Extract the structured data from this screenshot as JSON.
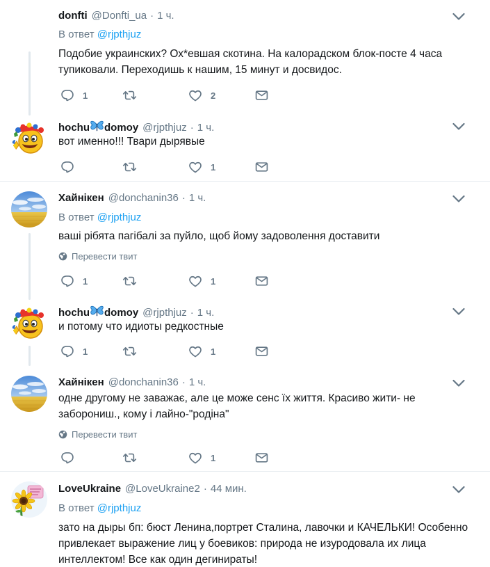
{
  "labels": {
    "reply_prefix": "В ответ",
    "translate": "Перевести твит",
    "dot": "·"
  },
  "tweets": [
    {
      "fullname": "donfti",
      "username": "@Donfti_ua",
      "time": "1 ч.",
      "reply_to": "@rjpthjuz",
      "text": "Подобие украинских? Ох*евшая скотина. На калорадском блок-посте 4 часа тупиковали. Переходишь к нашим, 15 минут и досвидос.",
      "reply_count": "1",
      "like_count": "2"
    },
    {
      "fullname_a": "hochu",
      "fullname_b": "domoy",
      "username": "@rjpthjuz",
      "time": "1 ч.",
      "text": "вот именно!!! Твари дырявые",
      "reply_count": "",
      "like_count": "1"
    },
    {
      "fullname": "Хайнікен",
      "username": "@donchanin36",
      "time": "1 ч.",
      "reply_to": "@rjpthjuz",
      "text": "ваші рібята пагібалі за пуйло, щоб йому задоволення доставити",
      "reply_count": "1",
      "like_count": "1"
    },
    {
      "fullname_a": "hochu",
      "fullname_b": "domoy",
      "username": "@rjpthjuz",
      "time": "1 ч.",
      "text": "и потому что идиоты редкостные",
      "reply_count": "1",
      "like_count": "1"
    },
    {
      "fullname": "Хайнікен",
      "username": "@donchanin36",
      "time": "1 ч.",
      "text": "одне другому не заважає, але це може сенс їх життя. Красиво жити- не заборониш., кому і лайно-\"родіна\"",
      "reply_count": "",
      "like_count": "1"
    },
    {
      "fullname": "LoveUkraine",
      "username": "@LoveUkraine2",
      "time": "44 мин.",
      "reply_to": "@rjpthjuz",
      "text": "зато на дыры бп: бюст Ленина,портрет Сталина, лавочки и КАЧЕЛЬКИ! Особенно привлекает выражение лиц у боевиков: природа не изуродовала их лица интеллектом! Все как один   дегинираты!"
    }
  ],
  "colors": {
    "text": "#14171a",
    "muted": "#657786",
    "link": "#1da1f2",
    "divider": "#e6ecf0",
    "thread_line": "#e1e8ed"
  },
  "icons": {
    "reply": "reply-icon",
    "retweet": "retweet-icon",
    "like": "heart-icon",
    "dm": "envelope-icon",
    "caret": "chevron-down-icon",
    "globe": "globe-icon",
    "butterfly": "butterfly-icon"
  }
}
